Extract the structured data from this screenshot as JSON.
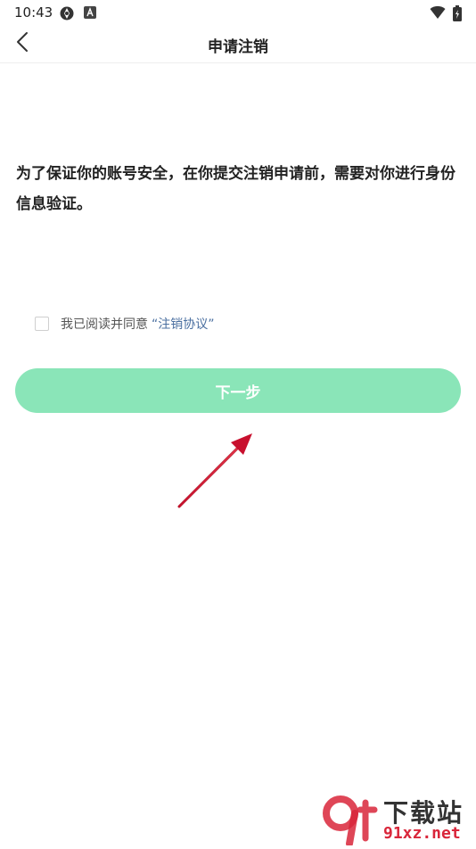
{
  "status_bar": {
    "time": "10:43",
    "icons": [
      "sync-icon",
      "a-badge-icon",
      "wifi-icon",
      "battery-icon"
    ]
  },
  "nav": {
    "title": "申请注销",
    "back_icon": "chevron-left-icon"
  },
  "main": {
    "notice": "为了保证你的账号安全，在你提交注销申请前，需要对你进行身份信息验证。",
    "agreement": {
      "checked": false,
      "text": "我已阅读并同意",
      "link": "“注销协议”"
    },
    "next_button": "下一步"
  },
  "watermark": {
    "logo_text": "9f",
    "title": "下载站",
    "site": "91xz.net"
  },
  "colors": {
    "button": "#8ae5b8",
    "link": "#4a6fa0",
    "arrow": "#d9263a"
  }
}
